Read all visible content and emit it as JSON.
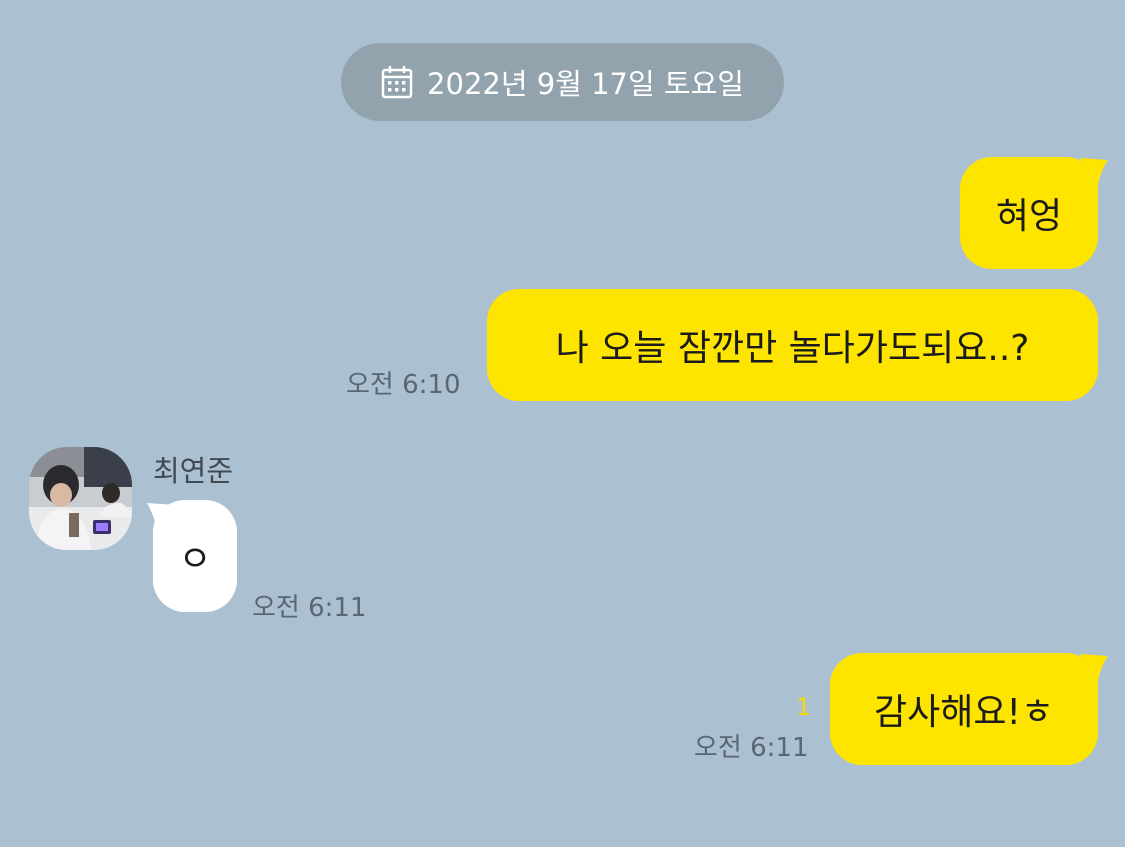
{
  "date_divider": {
    "icon": "calendar-icon",
    "text": "2022년 9월 17일 토요일"
  },
  "messages": [
    {
      "from": "me",
      "text": "혀엉"
    },
    {
      "from": "me",
      "text": "나 오늘 잠깐만 놀다가도되요..?",
      "time": "오전 6:10"
    },
    {
      "from": "them",
      "sender": "최연준",
      "text": "ㅇ",
      "time": "오전 6:11"
    },
    {
      "from": "me",
      "text": "감사해요!ㅎ",
      "time": "오전 6:11",
      "unread_count": "1"
    }
  ],
  "colors": {
    "background": "#abc1d1",
    "my_bubble": "#fee500",
    "their_bubble": "#ffffff",
    "date_pill": "#93a3ae",
    "unread": "#f5d900"
  }
}
